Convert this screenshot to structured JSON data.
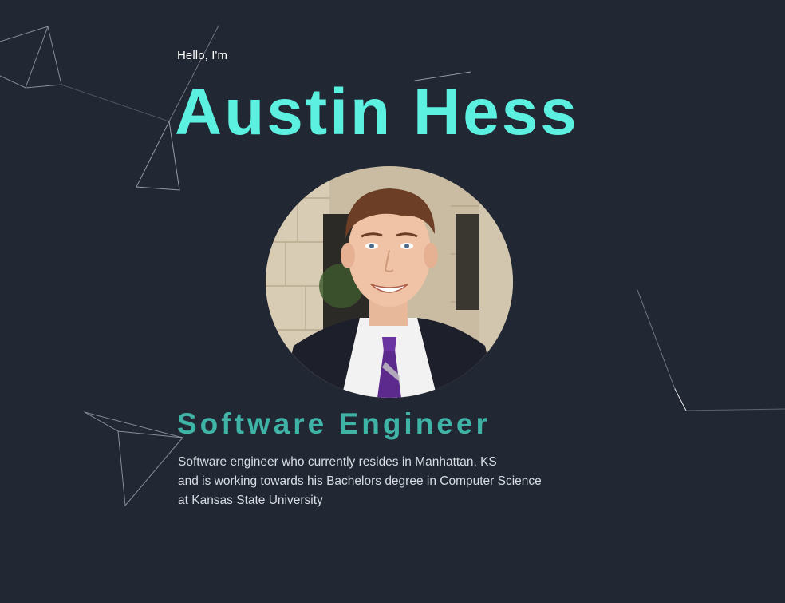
{
  "hero": {
    "greeting": "Hello, I'm",
    "name": "Austin Hess",
    "role": "Software Engineer",
    "bio_lines": [
      "Software engineer who currently resides in Manhattan, KS",
      "and is working towards his Bachelors degree in Computer Science",
      "at Kansas State University"
    ],
    "portrait_icon": "profile-photo"
  },
  "colors": {
    "background": "#212733",
    "name": "#5cf0e0",
    "role": "#3fb3a6",
    "greeting": "#ffffff",
    "bio": "#d8dce3",
    "lines": "#a9aeb7"
  }
}
